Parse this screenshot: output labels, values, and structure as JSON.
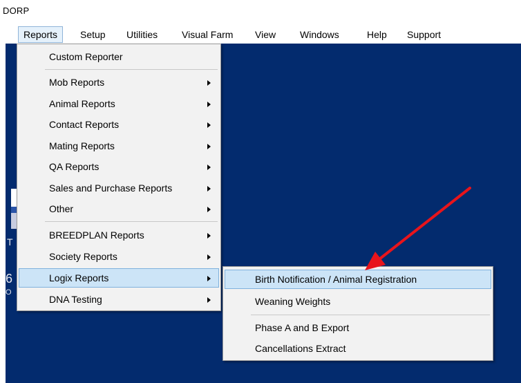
{
  "window": {
    "title": "DORP"
  },
  "menubar": {
    "items": [
      {
        "label": "Reports"
      },
      {
        "label": "Setup"
      },
      {
        "label": "Utilities"
      },
      {
        "label": "Visual Farm"
      },
      {
        "label": "View"
      },
      {
        "label": "Windows"
      },
      {
        "label": "Help"
      },
      {
        "label": "Support"
      }
    ]
  },
  "workspace": {
    "fragments": [
      "T",
      "6",
      "O"
    ]
  },
  "reports_menu": {
    "items": [
      {
        "label": "Custom Reporter"
      },
      {
        "label": "Mob Reports"
      },
      {
        "label": "Animal Reports"
      },
      {
        "label": "Contact Reports"
      },
      {
        "label": "Mating Reports"
      },
      {
        "label": "QA Reports"
      },
      {
        "label": "Sales and Purchase Reports"
      },
      {
        "label": "Other"
      },
      {
        "label": "BREEDPLAN Reports"
      },
      {
        "label": "Society Reports"
      },
      {
        "label": "Logix Reports"
      },
      {
        "label": "DNA Testing"
      }
    ]
  },
  "logix_submenu": {
    "items": [
      {
        "label": "Birth Notification / Animal Registration"
      },
      {
        "label": "Weaning Weights"
      },
      {
        "label": "Phase A and B Export"
      },
      {
        "label": "Cancellations Extract"
      }
    ]
  },
  "colors": {
    "workspace_bg": "#032b6e",
    "highlight_bg": "#cce4f7",
    "annotation_arrow": "#e8141b"
  },
  "icons": {
    "submenu_indicator": "chevron-right-icon",
    "annotation": "red-arrow-icon"
  }
}
